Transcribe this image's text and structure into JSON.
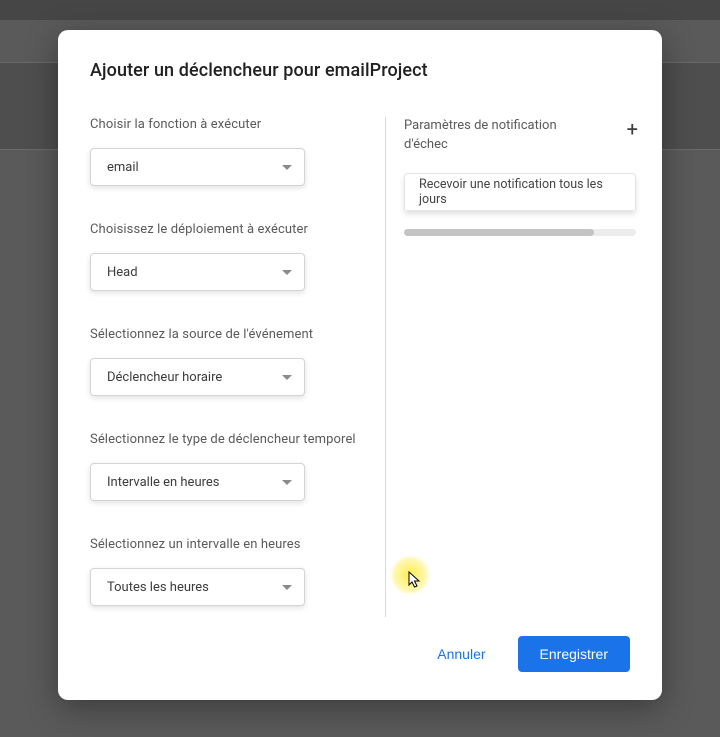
{
  "dialog": {
    "title": "Ajouter un déclencheur pour emailProject"
  },
  "left": {
    "functionLabel": "Choisir la fonction à exécuter",
    "functionValue": "email",
    "deploymentLabel": "Choisissez le déploiement à exécuter",
    "deploymentValue": "Head",
    "sourceLabel": "Sélectionnez la source de l'événement",
    "sourceValue": "Déclencheur horaire",
    "triggerTypeLabel": "Sélectionnez le type de déclencheur temporel",
    "triggerTypeValue": "Intervalle en heures",
    "intervalLabel": "Sélectionnez un intervalle en heures",
    "intervalValue": "Toutes les heures"
  },
  "right": {
    "notifHeader": "Paramètres de notification d'échec",
    "notifValue": "Recevoir une notification tous les jours"
  },
  "footer": {
    "cancel": "Annuler",
    "save": "Enregistrer"
  }
}
